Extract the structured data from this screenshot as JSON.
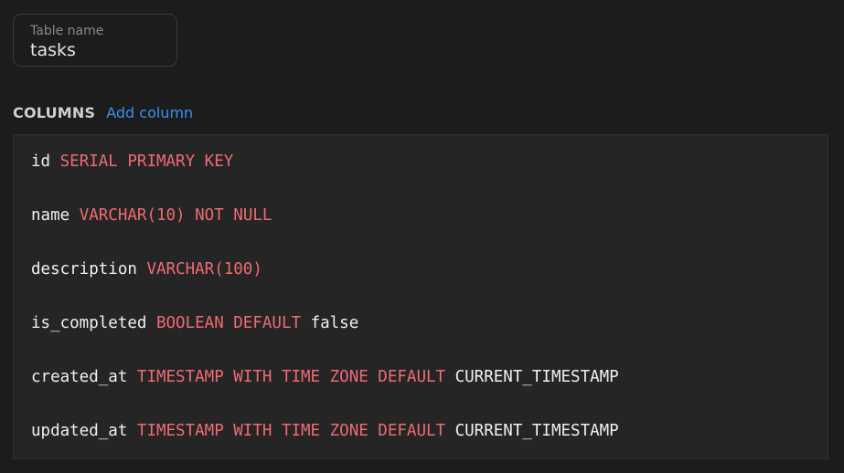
{
  "table_name": {
    "label": "Table name",
    "value": "tasks"
  },
  "columns_section": {
    "title": "COLUMNS",
    "add_label": "Add column"
  },
  "colors": {
    "background": "#1c1c1c",
    "keyword": "#ef6b73",
    "link": "#3d8ff0",
    "text": "#f0f0f0"
  },
  "columns": [
    {
      "name": "id",
      "type": "SERIAL PRIMARY KEY",
      "value": ""
    },
    {
      "name": "name",
      "type": "VARCHAR(10) NOT NULL",
      "value": ""
    },
    {
      "name": "description",
      "type": "VARCHAR(100)",
      "value": ""
    },
    {
      "name": "is_completed",
      "type": "BOOLEAN DEFAULT",
      "value": "false"
    },
    {
      "name": "created_at",
      "type": "TIMESTAMP WITH TIME ZONE DEFAULT",
      "value": "CURRENT_TIMESTAMP"
    },
    {
      "name": "updated_at",
      "type": "TIMESTAMP WITH TIME ZONE DEFAULT",
      "value": "CURRENT_TIMESTAMP"
    }
  ]
}
